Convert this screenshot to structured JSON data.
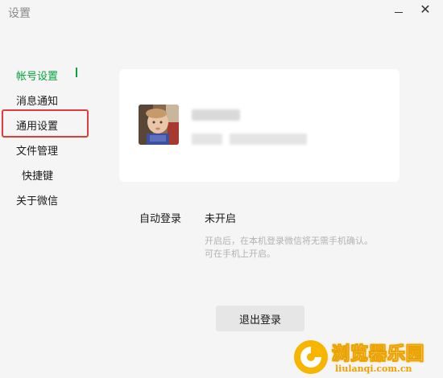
{
  "window": {
    "title": "设置",
    "minimize_icon": "minimize-icon",
    "close_icon": "close-icon",
    "close_glyph": "✕"
  },
  "sidebar": {
    "items": [
      {
        "label": "帐号设置",
        "active": true
      },
      {
        "label": "消息通知",
        "active": false
      },
      {
        "label": "通用设置",
        "active": false,
        "highlighted": true
      },
      {
        "label": "文件管理",
        "active": false
      },
      {
        "label": "快捷键",
        "active": false
      },
      {
        "label": "关于微信",
        "active": false
      }
    ],
    "active_color": "#07a33b",
    "highlight_color": "#e23b3b"
  },
  "account": {
    "avatar_icon": "user-avatar-photo",
    "name": "",
    "wechat_id": ""
  },
  "auto_login": {
    "label": "自动登录",
    "status": "未开启",
    "hint_line1": "开启后，在本机登录微信将无需手机确认。",
    "hint_line2": "可在手机上开启。"
  },
  "logout_button": {
    "label": "退出登录"
  },
  "watermark": {
    "title": "浏览器乐园",
    "url": "liulanqi.com.cn",
    "color": "#f0a000"
  }
}
